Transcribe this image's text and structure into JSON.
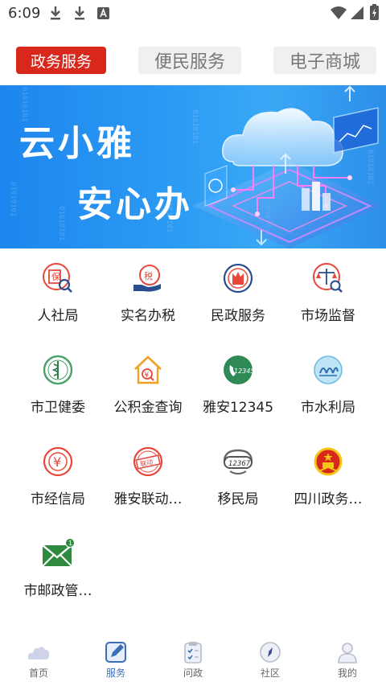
{
  "status_bar": {
    "time": "6:09",
    "icons": [
      "download-icon",
      "download-icon",
      "font-icon",
      "wifi-icon",
      "signal-icon",
      "battery-icon"
    ]
  },
  "top_tabs": [
    {
      "label": "政务服务",
      "active": true
    },
    {
      "label": "便民服务",
      "active": false
    },
    {
      "label": "电子商城",
      "active": false
    }
  ],
  "banner": {
    "line1": "云小雅",
    "line2": "安心办",
    "binary_text": "01010101"
  },
  "services": [
    {
      "label": "人社局",
      "icon": "insurance-magnifier-icon"
    },
    {
      "label": "实名办税",
      "icon": "tax-hand-icon"
    },
    {
      "label": "民政服务",
      "icon": "civil-affairs-icon"
    },
    {
      "label": "市场监督",
      "icon": "scales-magnifier-icon"
    },
    {
      "label": "市卫健委",
      "icon": "health-caduceus-icon"
    },
    {
      "label": "公积金查询",
      "icon": "housing-fund-icon"
    },
    {
      "label": "雅安12345",
      "icon": "hotline-12345-icon"
    },
    {
      "label": "市水利局",
      "icon": "water-resources-icon"
    },
    {
      "label": "市经信局",
      "icon": "yuan-coin-icon"
    },
    {
      "label": "雅安联动…",
      "icon": "linkage-stamp-icon"
    },
    {
      "label": "移民局",
      "icon": "immigration-12367-icon"
    },
    {
      "label": "四川政务…",
      "icon": "national-emblem-icon"
    },
    {
      "label": "市邮政管…",
      "icon": "mail-envelope-icon",
      "badge": "1"
    }
  ],
  "bottom_nav": [
    {
      "label": "首页",
      "icon": "home-cloud-icon",
      "active": false
    },
    {
      "label": "服务",
      "icon": "service-edit-icon",
      "active": true
    },
    {
      "label": "问政",
      "icon": "checklist-icon",
      "active": false
    },
    {
      "label": "社区",
      "icon": "compass-icon",
      "active": false
    },
    {
      "label": "我的",
      "icon": "profile-icon",
      "active": false
    }
  ],
  "colors": {
    "accent_red": "#d7281b",
    "tab_inactive_bg": "#f0f0f0",
    "banner_blue": "#2b9bf4",
    "nav_active": "#3b6fb5"
  }
}
